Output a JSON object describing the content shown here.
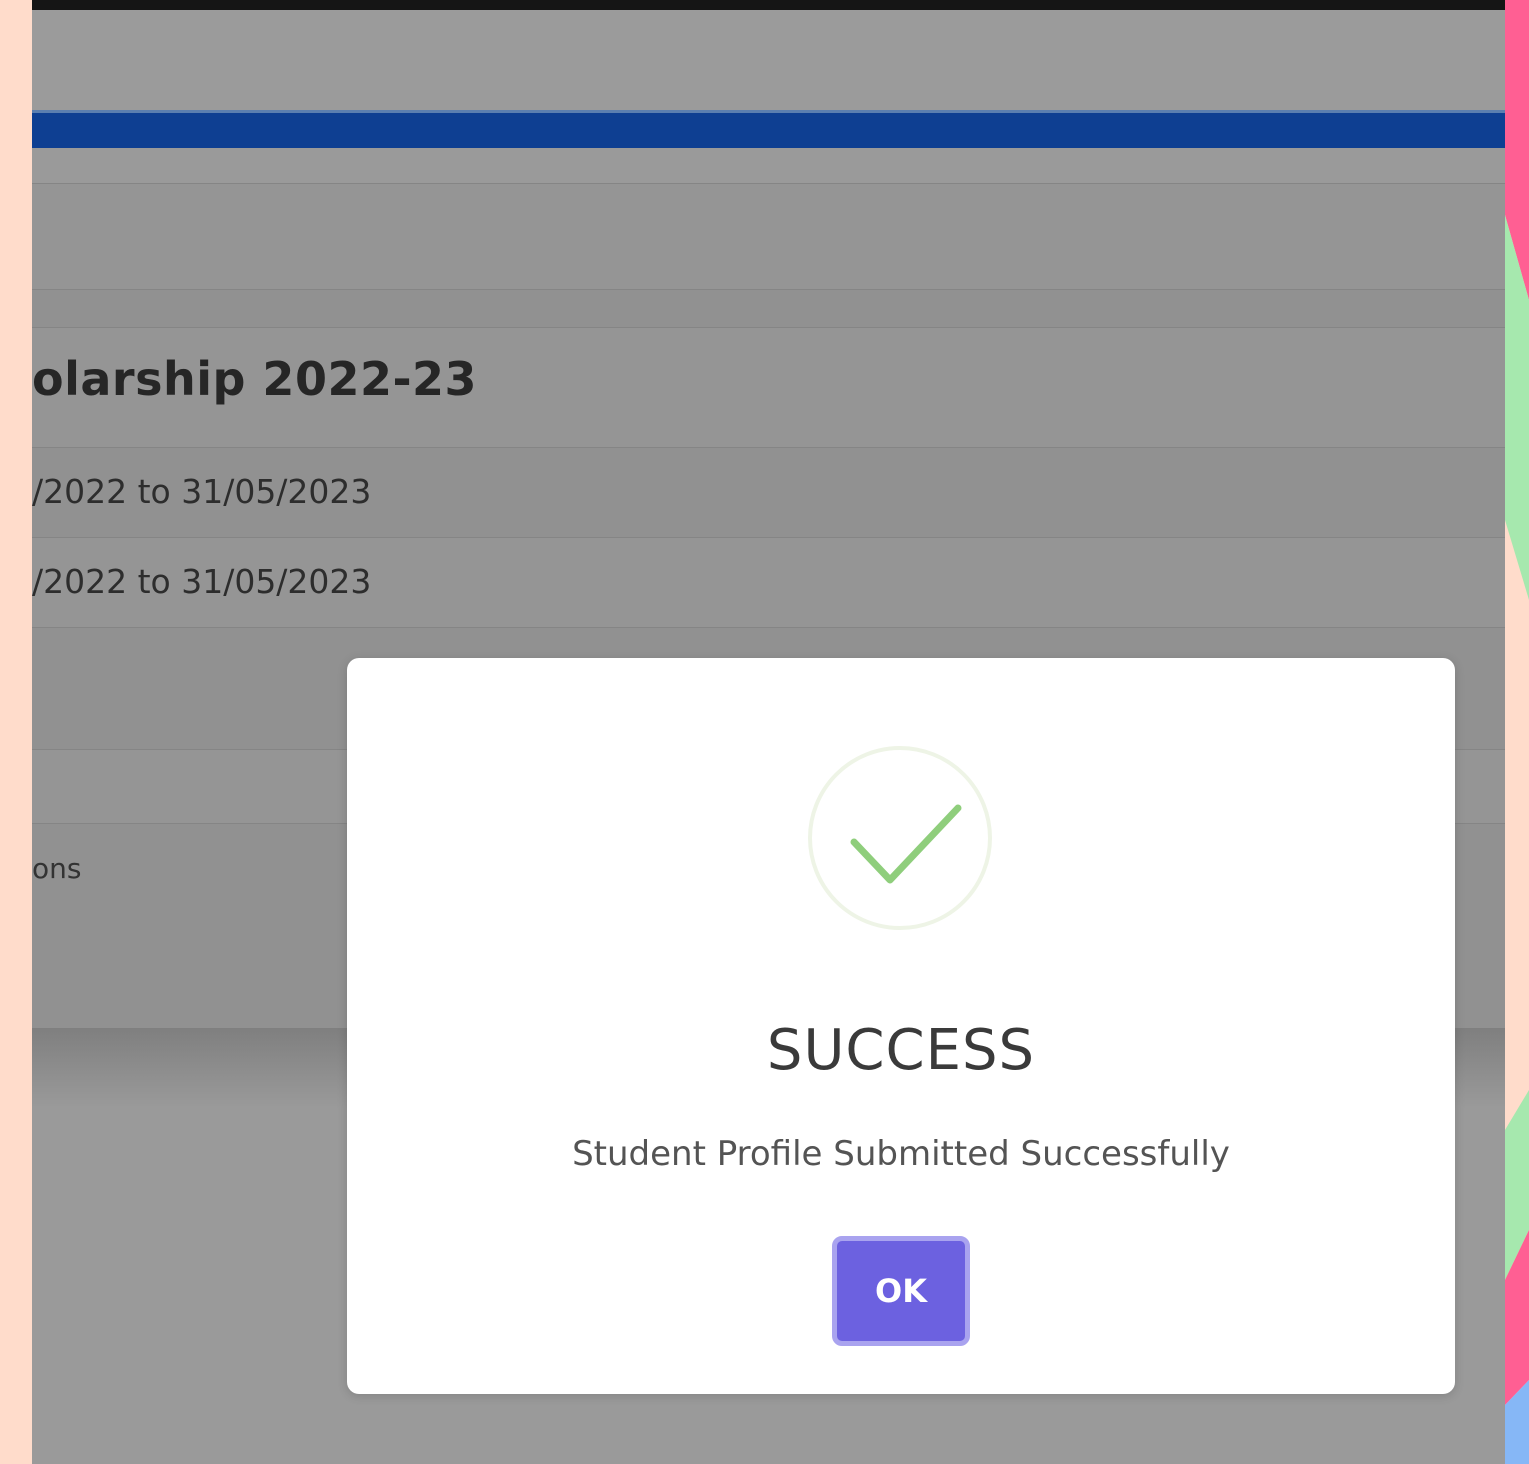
{
  "background_page": {
    "title_fragment": "olarship 2022-23",
    "date_rows": [
      "/2022 to 31/05/2023",
      "/2022 to 31/05/2023"
    ],
    "partial_label": "ons"
  },
  "dialog": {
    "icon": "check-circle-icon",
    "title": "SUCCESS",
    "message": "Student Profile Submitted Successfully",
    "ok_label": "OK"
  },
  "colors": {
    "top_nav": "#0e3f92",
    "ok_button": "#6c61e0",
    "success_check": "#8fce7c",
    "backdrop": "#9a9a9a"
  }
}
